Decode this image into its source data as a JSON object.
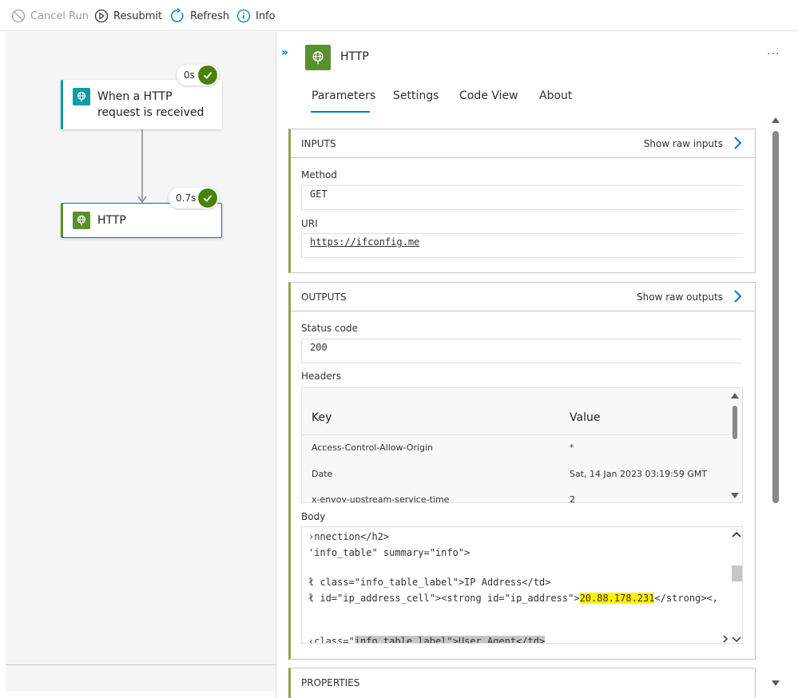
{
  "toolbar": {
    "cancel_run": "Cancel Run",
    "resubmit": "Resubmit",
    "refresh": "Refresh",
    "info": "Info"
  },
  "canvas": {
    "trigger": {
      "title": "When a HTTP request is received",
      "duration": "0s"
    },
    "action": {
      "title": "HTTP",
      "duration": "0.7s"
    }
  },
  "panel": {
    "title": "HTTP",
    "ellipsis": "...",
    "tabs": [
      "Parameters",
      "Settings",
      "Code View",
      "About"
    ],
    "inputs": {
      "header": "INPUTS",
      "raw_link": "Show raw inputs",
      "method_label": "Method",
      "method_value": "GET",
      "uri_label": "URI",
      "uri_value": "https://ifconfig.me"
    },
    "outputs": {
      "header": "OUTPUTS",
      "raw_link": "Show raw outputs",
      "status_label": "Status code",
      "status_value": "200",
      "headers_label": "Headers",
      "headers_columns": [
        "Key",
        "Value"
      ],
      "headers_rows": [
        {
          "key": "Access-Control-Allow-Origin",
          "value": "*"
        },
        {
          "key": "Date",
          "value": "Sat, 14 Jan 2023 03:19:59 GMT"
        },
        {
          "key": "x-envoy-upstream-service-time",
          "value": "2"
        }
      ],
      "body_label": "Body",
      "body_lines": {
        "l1": "›nnection</h2>",
        "l2": "'info_table\" summary=\"info\">",
        "l3": "ł class=\"info_table_label\">IP Address</td>",
        "l4_pre": "ł id=\"ip_address_cell\"><strong id=\"ip_address\">",
        "l4_ip": "20.88.178.231",
        "l4_post": "</strong><,",
        "l5_pre": "‹class=\"",
        "l5_sel": "info_table_label\">User Agent</td>"
      }
    },
    "properties_header": "PROPERTIES"
  },
  "colors": {
    "accent_blue": "#0078d4",
    "success_green": "#498205",
    "http_icon_green": "#5a8f2f",
    "trigger_icon_teal": "#0f9aa5",
    "card_accent": "#8ca94a",
    "highlight_yellow": "#fff100"
  }
}
